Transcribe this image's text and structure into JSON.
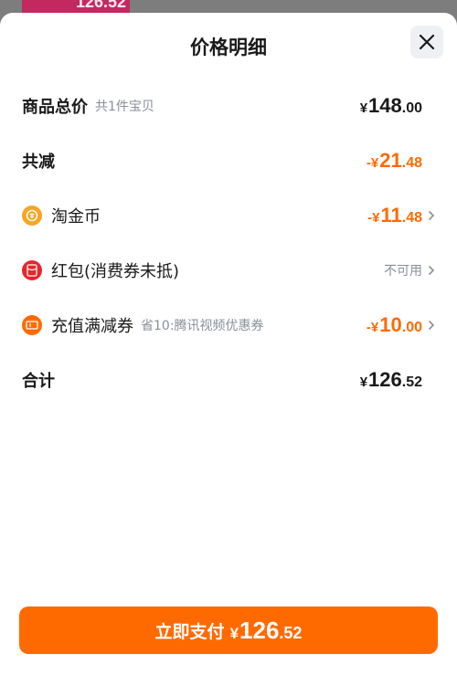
{
  "background": {
    "peek_amount": "126.52"
  },
  "sheet": {
    "title": "价格明细"
  },
  "rows": {
    "total_goods": {
      "label": "商品总价",
      "sub": "共1件宝贝",
      "yen": "¥",
      "int": "148",
      "dec": ".00"
    },
    "total_reduce": {
      "label": "共减",
      "yen": "-¥",
      "int": "21",
      "dec": ".48"
    },
    "taojinbi": {
      "label": "淘金币",
      "icon": "coin-icon",
      "yen": "-¥",
      "int": "11",
      "dec": ".48"
    },
    "hongbao": {
      "label": "红包(消费券未抵)",
      "icon": "red-packet-icon",
      "status": "不可用"
    },
    "recharge": {
      "label": "充值满减券",
      "sub": "省10:腾讯视频优惠券",
      "icon": "coupon-icon",
      "yen": "-¥",
      "int": "10",
      "dec": ".00"
    },
    "sum": {
      "label": "合计",
      "yen": "¥",
      "int": "126",
      "dec": ".52"
    }
  },
  "pay_button": {
    "label": "立即支付",
    "yen": "¥",
    "int": "126",
    "dec": ".52"
  },
  "colors": {
    "accent": "#ff6a00",
    "coin": "#f5a623",
    "red_packet": "#e8252b",
    "text": "#1a1a1a",
    "muted": "#8a8f99"
  }
}
